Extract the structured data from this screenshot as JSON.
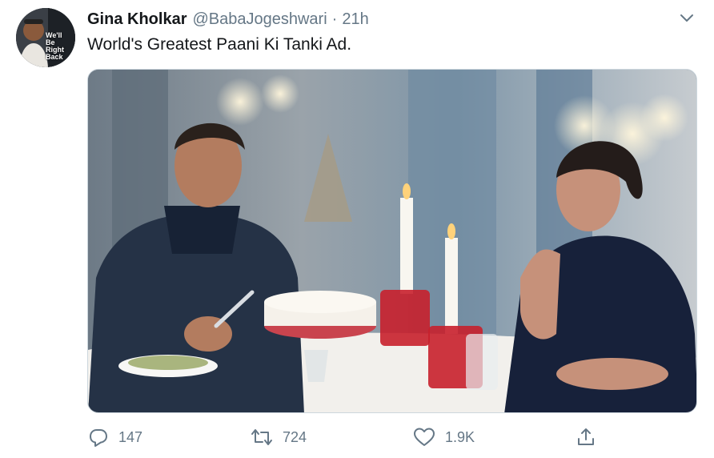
{
  "tweet": {
    "author": {
      "display_name": "Gina Kholkar",
      "handle": "@BabaJogeshwari",
      "avatar_text": "We'll\nBe\nRight\nBack"
    },
    "separator": "·",
    "time": "21h",
    "text": "World's Greatest Paani Ki Tanki Ad.",
    "media": {
      "kind": "video-still",
      "icon": "image"
    }
  },
  "actions": {
    "reply": {
      "icon": "reply-icon",
      "count": "147"
    },
    "retweet": {
      "icon": "retweet-icon",
      "count": "724"
    },
    "like": {
      "icon": "heart-icon",
      "count": "1.9K"
    },
    "share": {
      "icon": "share-icon"
    }
  },
  "colors": {
    "text": "#14171a",
    "muted": "#657786",
    "border": "#ccd6dd"
  }
}
